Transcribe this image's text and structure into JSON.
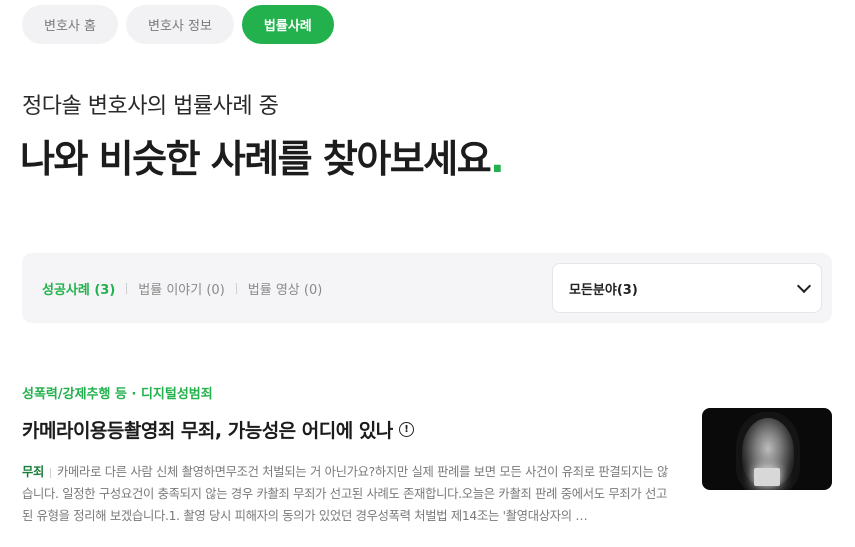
{
  "tabs": [
    {
      "label": "변호사 홈"
    },
    {
      "label": "변호사 정보"
    },
    {
      "label": "법률사례",
      "active": true
    }
  ],
  "intro": "정다솔 변호사의 법률사례 중",
  "headline": "나와 비슷한 사례를 찾아보세요",
  "headline_dot": ".",
  "filters": [
    {
      "label": "성공사례 (3)",
      "active": true
    },
    {
      "label": "법률 이야기 (0)"
    },
    {
      "label": "법률 영상 (0)"
    }
  ],
  "select": {
    "value": "모든분야(3)"
  },
  "case": {
    "category": "성폭력/강제추행 등 · 디지털성범죄",
    "title": "카메라이용등촬영죄 무죄, 가능성은 어디에 있나",
    "result": "무죄",
    "body": "카메라로 다른 사람 신체 촬영하면무조건 처벌되는 거 아닌가요?하지만 실제 판례를 보면 모든 사건이 유죄로 판결되지는 않습니다. 일정한 구성요건이 충족되지 않는 경우 카촬죄 무죄가 선고된 사례도 존재합니다.오늘은 카촬죄 판례 중에서도 무죄가 선고된 유형을 정리해 보겠습니다.1. 촬영 당시 피해자의 동의가 있었던 경우성폭력 처벌법 제14조는 '촬영대상자의 …",
    "thumbnail_icon": "video-thumbnail"
  },
  "colors": {
    "accent": "#22b14c",
    "result": "#1a7d3a"
  }
}
